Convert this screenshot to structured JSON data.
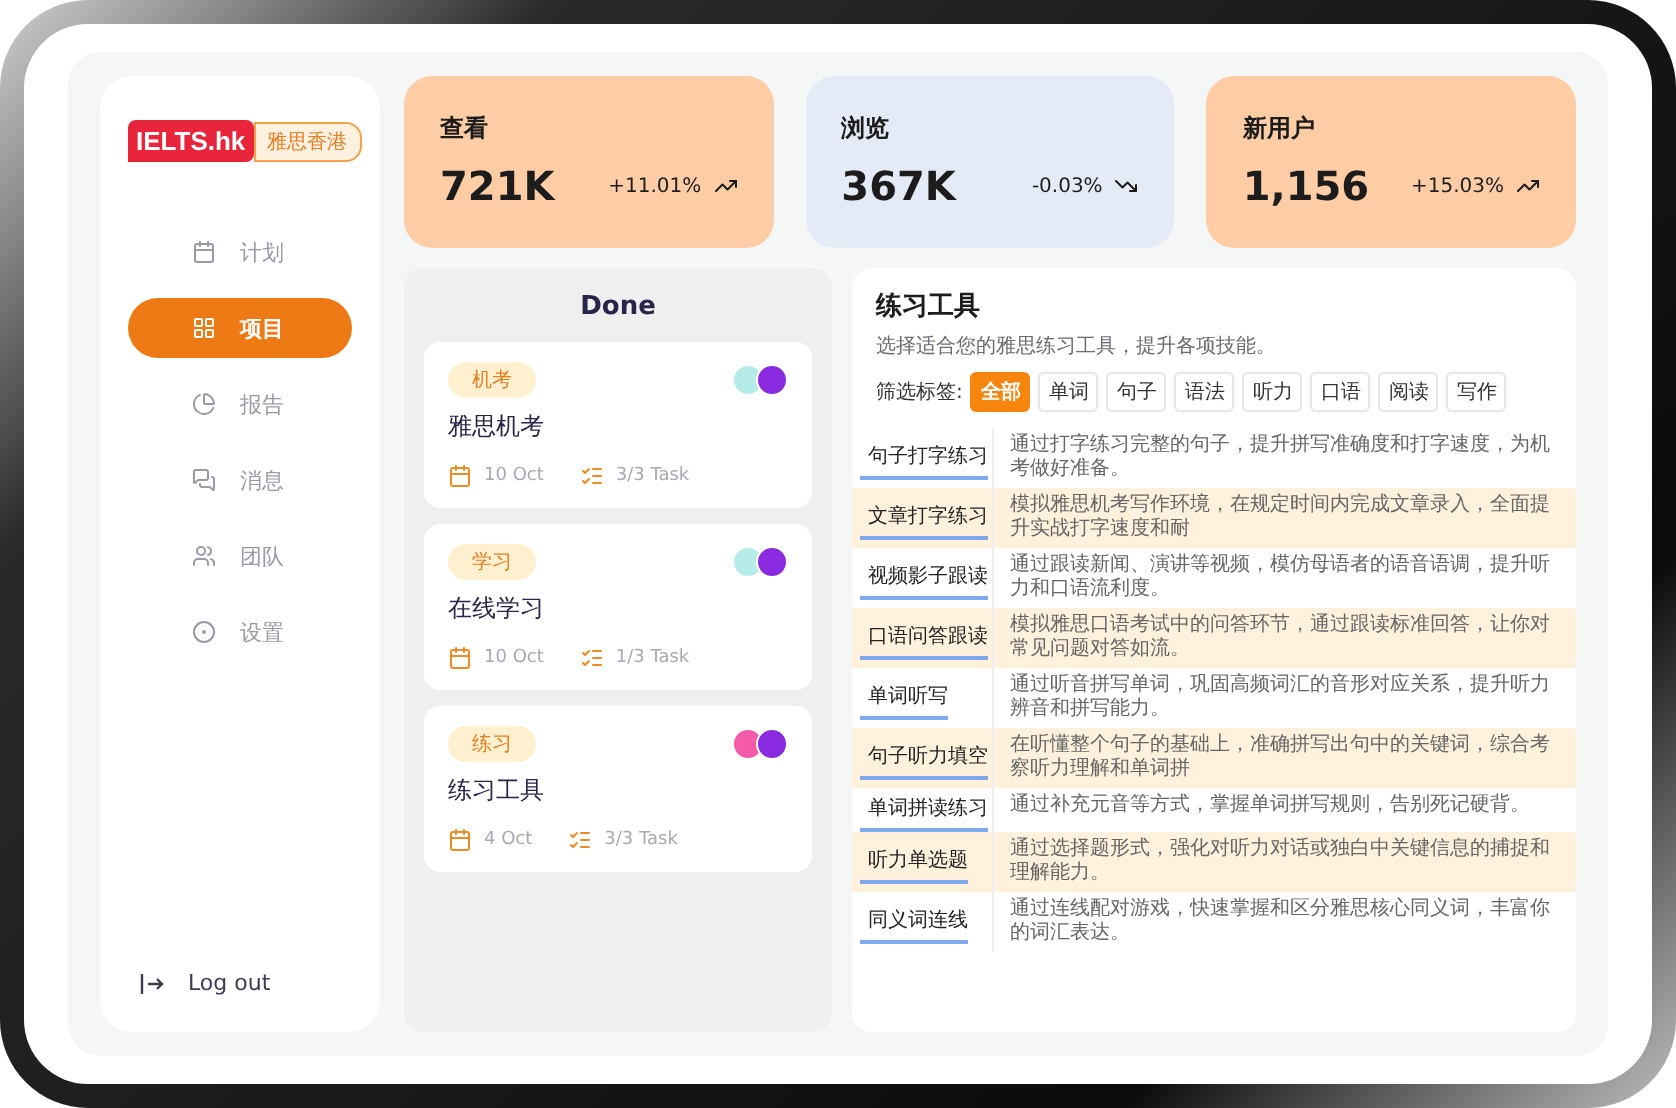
{
  "sidebar": {
    "logo": {
      "brand": "IELTS.hk",
      "tagline": "雅思香港"
    },
    "items": [
      {
        "label": "计划",
        "selected": false
      },
      {
        "label": "项目",
        "selected": true
      },
      {
        "label": "报告",
        "selected": false
      },
      {
        "label": "消息",
        "selected": false
      },
      {
        "label": "团队",
        "selected": false
      },
      {
        "label": "设置",
        "selected": false
      }
    ],
    "logout": "Log out"
  },
  "stats": [
    {
      "title": "查看",
      "value": "721K",
      "change": "+11.01%",
      "kind": "up",
      "color": "#fecda5"
    },
    {
      "title": "浏览",
      "value": "367K",
      "change": "-0.03%",
      "kind": "down",
      "color": "#e5ebf6"
    },
    {
      "title": "新用户",
      "value": "1,156",
      "change": "+15.03%",
      "kind": "up",
      "color": "#fecda5"
    }
  ],
  "board": {
    "title": "Done",
    "cards": [
      {
        "tag": "机考",
        "title": "雅思机考",
        "date": "10 Oct",
        "tasks": "3/3 Task",
        "avatars": [
          {
            "color": "#b6ece8"
          },
          {
            "color": "#8a2be2"
          }
        ]
      },
      {
        "tag": "学习",
        "title": "在线学习",
        "date": "10 Oct",
        "tasks": "1/3 Task",
        "avatars": [
          {
            "color": "#b6ece8"
          },
          {
            "color": "#8a2be2"
          }
        ]
      },
      {
        "tag": "练习",
        "title": "练习工具",
        "date": "4 Oct",
        "tasks": "3/3 Task",
        "avatars": [
          {
            "color": "#f45aa8"
          },
          {
            "color": "#8a2be2"
          }
        ]
      }
    ]
  },
  "tools": {
    "title": "练习工具",
    "subtitle": "选择适合您的雅思练习工具，提升各项技能。",
    "filter_label": "筛选标签:",
    "filters": [
      {
        "label": "全部",
        "selected": true
      },
      {
        "label": "单词",
        "selected": false
      },
      {
        "label": "句子",
        "selected": false
      },
      {
        "label": "语法",
        "selected": false
      },
      {
        "label": "听力",
        "selected": false
      },
      {
        "label": "口语",
        "selected": false
      },
      {
        "label": "阅读",
        "selected": false
      },
      {
        "label": "写作",
        "selected": false
      }
    ],
    "rows": [
      {
        "name": "句子打字练习",
        "description": "通过打字练习完整的句子，提升拼写准确度和打字速度，为机考做好准备。"
      },
      {
        "name": "文章打字练习",
        "description": "模拟雅思机考写作环境，在规定时间内完成文章录入，全面提升实战打字速度和耐"
      },
      {
        "name": "视频影子跟读",
        "description": "通过跟读新闻、演讲等视频，模仿母语者的语音语调，提升听力和口语流利度。"
      },
      {
        "name": "口语问答跟读",
        "description": "模拟雅思口语考试中的问答环节，通过跟读标准回答，让你对常见问题对答如流。"
      },
      {
        "name": "单词听写",
        "description": "通过听音拼写单词，巩固高频词汇的音形对应关系，提升听力辨音和拼写能力。"
      },
      {
        "name": "句子听力填空",
        "description": "在听懂整个句子的基础上，准确拼写出句中的关键词，综合考察听力理解和单词拼"
      },
      {
        "name": "单词拼读练习",
        "description": "通过补充元音等方式，掌握单词拼写规则，告别死记硬背。"
      },
      {
        "name": "听力单选题",
        "description": "通过选择题形式，强化对听力对话或独白中关键信息的捕捉和理解能力。"
      },
      {
        "name": "同义词连线",
        "description": "通过连线配对游戏，快速掌握和区分雅思核心同义词，丰富你的词汇表达。"
      }
    ]
  }
}
